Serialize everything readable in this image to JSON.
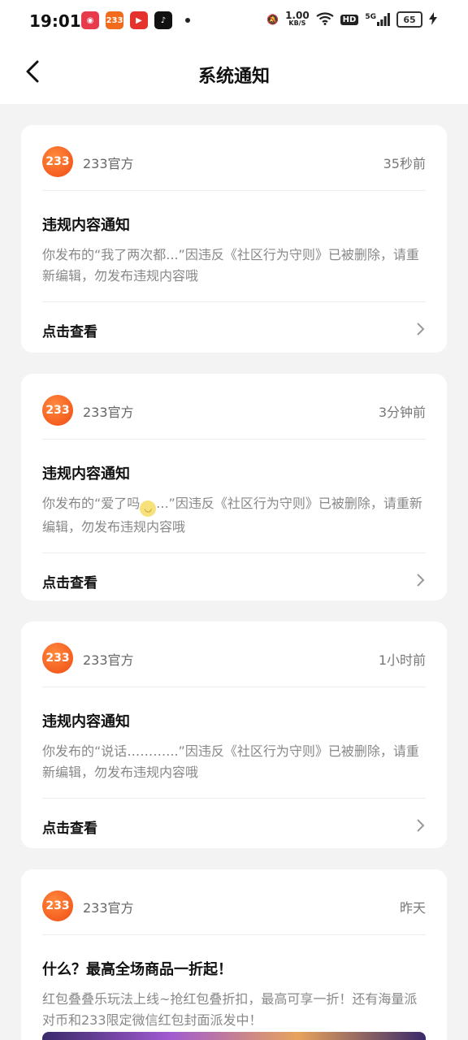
{
  "status_bar": {
    "time": "19:01",
    "net_speed": "1.00",
    "net_unit": "KB/S",
    "hd": "HD",
    "signal": "5G",
    "battery": "65"
  },
  "header": {
    "title": "系统通知"
  },
  "notifications": [
    {
      "sender": "233官方",
      "time": "35秒前",
      "title": "违规内容通知",
      "body": "你发布的“我了两次都...”因违反《社区行为守则》已被删除，请重新编辑，勿发布违规内容哦",
      "action": "点击查看"
    },
    {
      "sender": "233官方",
      "time": "3分钟前",
      "title": "违规内容通知",
      "body_prefix": "你发布的“爱了吗",
      "body_suffix": "...”因违反《社区行为守则》已被删除，请重新编辑，勿发布违规内容哦",
      "action": "点击查看"
    },
    {
      "sender": "233官方",
      "time": "1小时前",
      "title": "违规内容通知",
      "body": "你发布的“说话………...”因违反《社区行为守则》已被删除，请重新编辑，勿发布违规内容哦",
      "action": "点击查看"
    },
    {
      "sender": "233官方",
      "time": "昨天",
      "title": "什么？最高全场商品一折起！",
      "body": "红包叠叠乐玩法上线~抢红包叠折扣，最高可享一折！还有海量派对币和233限定微信红包封面派发中！"
    }
  ],
  "logo_text": "233",
  "colors": {
    "accent": "#f04b14",
    "background": "#f3f3f3"
  }
}
